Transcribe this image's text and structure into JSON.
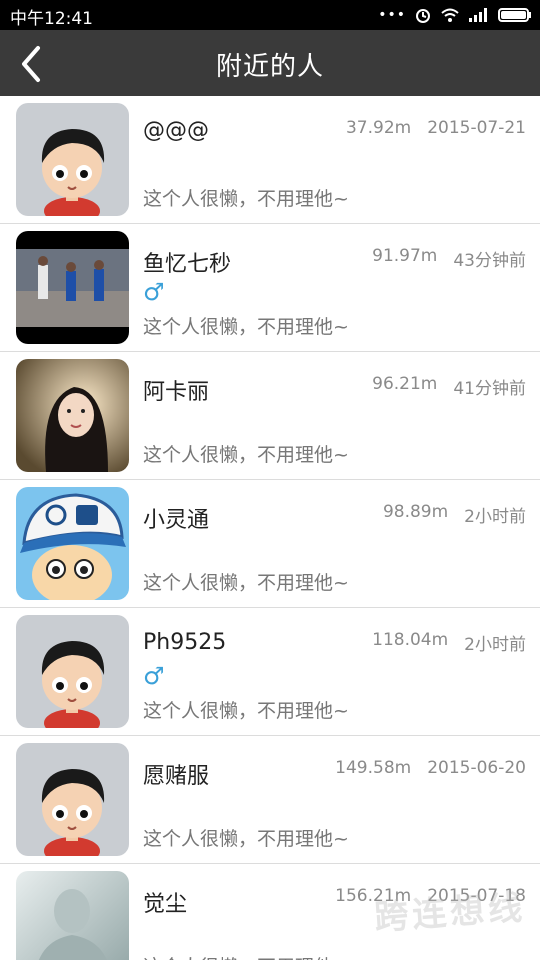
{
  "status": {
    "time": "中午12:41"
  },
  "header": {
    "title": "附近的人",
    "back_icon": "back-chevron-icon"
  },
  "items": [
    {
      "name": "@@@",
      "distance": "37.92m",
      "time": "2015-07-21",
      "gender": "",
      "signature": "这个人很懒，不用理他~",
      "avatar": "cartoon-boy"
    },
    {
      "name": "鱼忆七秒",
      "distance": "91.97m",
      "time": "43分钟前",
      "gender": "♂",
      "signature": "这个人很懒，不用理他~",
      "avatar": "basketball-photo"
    },
    {
      "name": "阿卡丽",
      "distance": "96.21m",
      "time": "41分钟前",
      "gender": "",
      "signature": "这个人很懒，不用理他~",
      "avatar": "girl-photo"
    },
    {
      "name": "小灵通",
      "distance": "98.89m",
      "time": "2小时前",
      "gender": "",
      "signature": "这个人很懒，不用理他~",
      "avatar": "cap-boy"
    },
    {
      "name": "Ph9525",
      "distance": "118.04m",
      "time": "2小时前",
      "gender": "♂",
      "signature": "这个人很懒，不用理他~",
      "avatar": "cartoon-boy"
    },
    {
      "name": "愿赌服",
      "distance": "149.58m",
      "time": "2015-06-20",
      "gender": "",
      "signature": "这个人很懒，不用理他~",
      "avatar": "cartoon-boy"
    },
    {
      "name": "觉尘",
      "distance": "156.21m",
      "time": "2015-07-18",
      "gender": "",
      "signature": "这个人很懒，不用理他~",
      "avatar": "ghost-photo"
    }
  ],
  "watermark": "跨连想线"
}
